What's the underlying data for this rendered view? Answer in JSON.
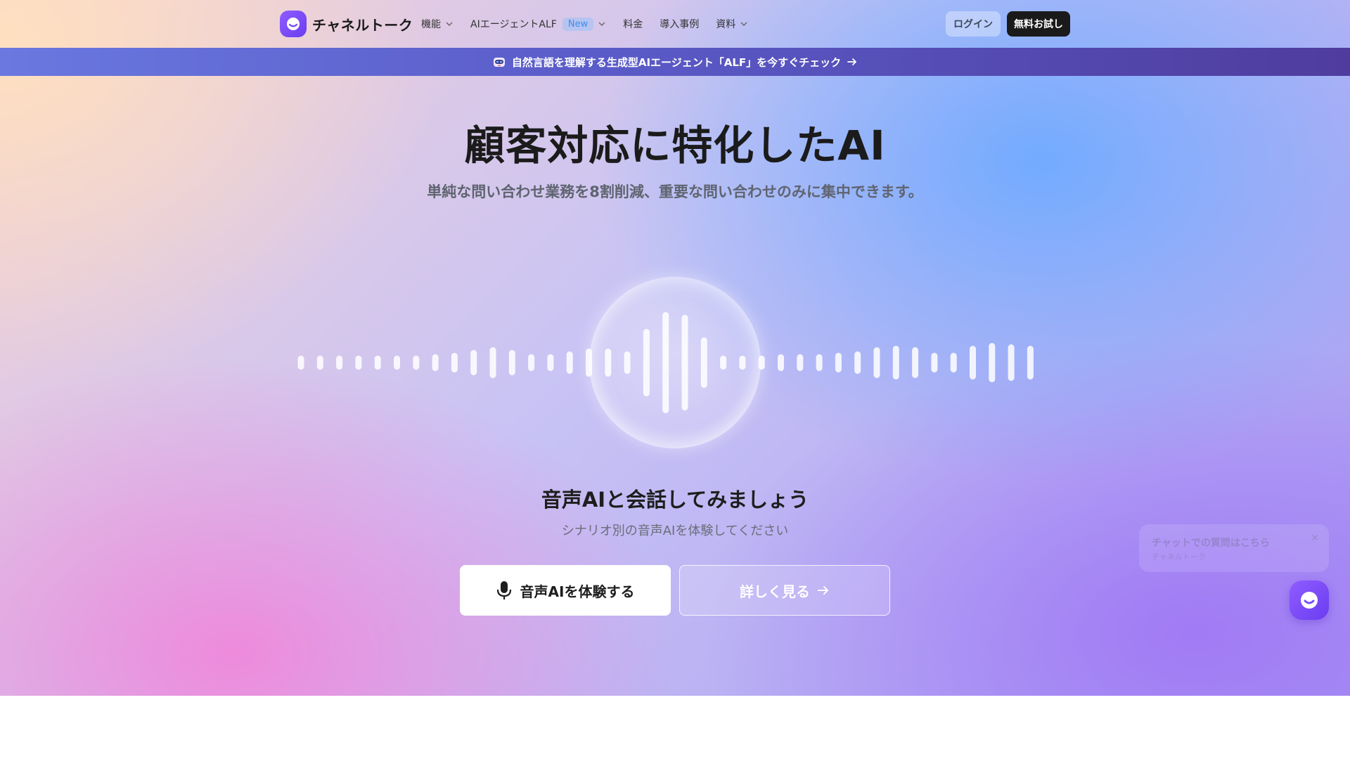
{
  "header": {
    "logo_text": "チャネルトーク",
    "nav": [
      {
        "label": "機能",
        "has_dropdown": true
      },
      {
        "label": "AIエージェントALF",
        "badge": "New",
        "has_dropdown": true
      },
      {
        "label": "料金",
        "has_dropdown": false
      },
      {
        "label": "導入事例",
        "has_dropdown": false
      },
      {
        "label": "資料",
        "has_dropdown": true
      }
    ],
    "login_label": "ログイン",
    "trial_label": "無料お試し"
  },
  "banner": {
    "text": "自然言語を理解する生成型AIエージェント「ALF」を今すぐチェック",
    "icon": "robot-icon"
  },
  "hero": {
    "title": "顧客対応に特化したAI",
    "subtitle": "単純な問い合わせ業務を8割削減、重要な問い合わせのみに集中できます。"
  },
  "voice": {
    "waveform_levels": [
      0.25,
      0.25,
      0.25,
      0.25,
      0.25,
      0.25,
      0.25,
      0.3,
      0.35,
      0.45,
      0.55,
      0.45,
      0.3,
      0.3,
      0.4,
      0.5,
      0.5,
      0.4,
      1.2,
      1.8,
      1.7,
      0.9,
      0.25,
      0.25,
      0.25,
      0.3,
      0.3,
      0.3,
      0.35,
      0.4,
      0.55,
      0.6,
      0.55,
      0.35,
      0.35,
      0.6,
      0.7,
      0.65,
      0.6
    ],
    "title": "音声AIと会話してみましょう",
    "subtitle": "シナリオ別の音声AIを体験してください",
    "try_label": "音声AIを体験する",
    "more_label": "詳しく見る"
  },
  "chat_widget": {
    "popup_title": "チャットでの質問はこちら",
    "popup_sub": "チャネルトーク",
    "close_icon": "close-icon",
    "launcher_icon": "chat-bubble-icon"
  },
  "colors": {
    "brand": "#7b4dff",
    "text_dark": "#1b1b1b",
    "banner": "#5a5bc8"
  }
}
